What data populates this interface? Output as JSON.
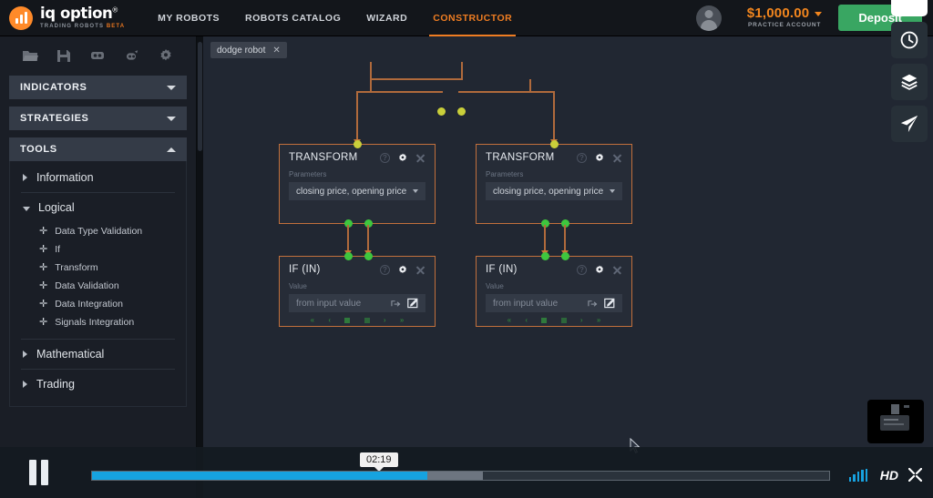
{
  "topnav": {
    "brand_name": "iq option",
    "brand_reg": "®",
    "brand_sub_main": "TRADING ROBOTS ",
    "brand_sub_beta": "BETA",
    "links": [
      {
        "label": "MY ROBOTS",
        "active": false
      },
      {
        "label": "ROBOTS CATALOG",
        "active": false
      },
      {
        "label": "WIZARD",
        "active": false
      },
      {
        "label": "CONSTRUCTOR",
        "active": true
      }
    ],
    "balance_amount": "$1,000.00",
    "balance_sub": "PRACTICE ACCOUNT",
    "deposit_label": "Deposit"
  },
  "sidebar": {
    "toolbar_icons": [
      {
        "name": "folder-icon"
      },
      {
        "name": "save-icon"
      },
      {
        "name": "robot-icon"
      },
      {
        "name": "link-icon"
      },
      {
        "name": "gear-icon"
      }
    ],
    "accordions": [
      {
        "title": "INDICATORS",
        "expanded": false
      },
      {
        "title": "STRATEGIES",
        "expanded": false
      },
      {
        "title": "TOOLS",
        "expanded": true
      }
    ],
    "tools_tree": [
      {
        "label": "Information",
        "expanded": false
      },
      {
        "label": "Logical",
        "expanded": true
      },
      {
        "label": "Mathematical",
        "expanded": false
      },
      {
        "label": "Trading",
        "expanded": false
      }
    ],
    "logical_children": [
      {
        "label": "Data Type Validation"
      },
      {
        "label": "If"
      },
      {
        "label": "Transform"
      },
      {
        "label": "Data Validation"
      },
      {
        "label": "Data Integration"
      },
      {
        "label": "Signals Integration"
      }
    ]
  },
  "canvas": {
    "tab_label": "dodge robot",
    "tab_close": "✕",
    "nodes": [
      {
        "id": "transform-left",
        "title": "TRANSFORM",
        "field_label": "Parameters",
        "field_value": "closing price, opening price",
        "kind": "transform"
      },
      {
        "id": "transform-right",
        "title": "TRANSFORM",
        "field_label": "Parameters",
        "field_value": "closing price, opening price",
        "kind": "transform"
      },
      {
        "id": "if-in-left",
        "title": "IF (IN)",
        "field_label": "Value",
        "field_value": "from input value",
        "kind": "if"
      },
      {
        "id": "if-in-right",
        "title": "IF (IN)",
        "field_label": "Value",
        "field_value": "from input value",
        "kind": "if"
      }
    ],
    "operators": [
      "«",
      "‹",
      "=",
      "≠",
      "›",
      "»"
    ],
    "port_color_output": "#c9cf3a",
    "port_color_input": "#3ec63e",
    "wire_color": "#b06a3c",
    "node_border_color": "#c2703c"
  },
  "right_toolbar": [
    {
      "name": "chat-bubble-icon"
    },
    {
      "name": "clock-history-icon"
    },
    {
      "name": "layers-icon"
    },
    {
      "name": "send-telegram-icon"
    }
  ],
  "player": {
    "pause_label": "Pause",
    "time_tooltip": "02:19",
    "progress_percent": 45.5,
    "buffered_percent": 53,
    "hd_label": "HD",
    "volume_name": "volume-icon",
    "fullscreen_name": "fullscreen-icon"
  }
}
